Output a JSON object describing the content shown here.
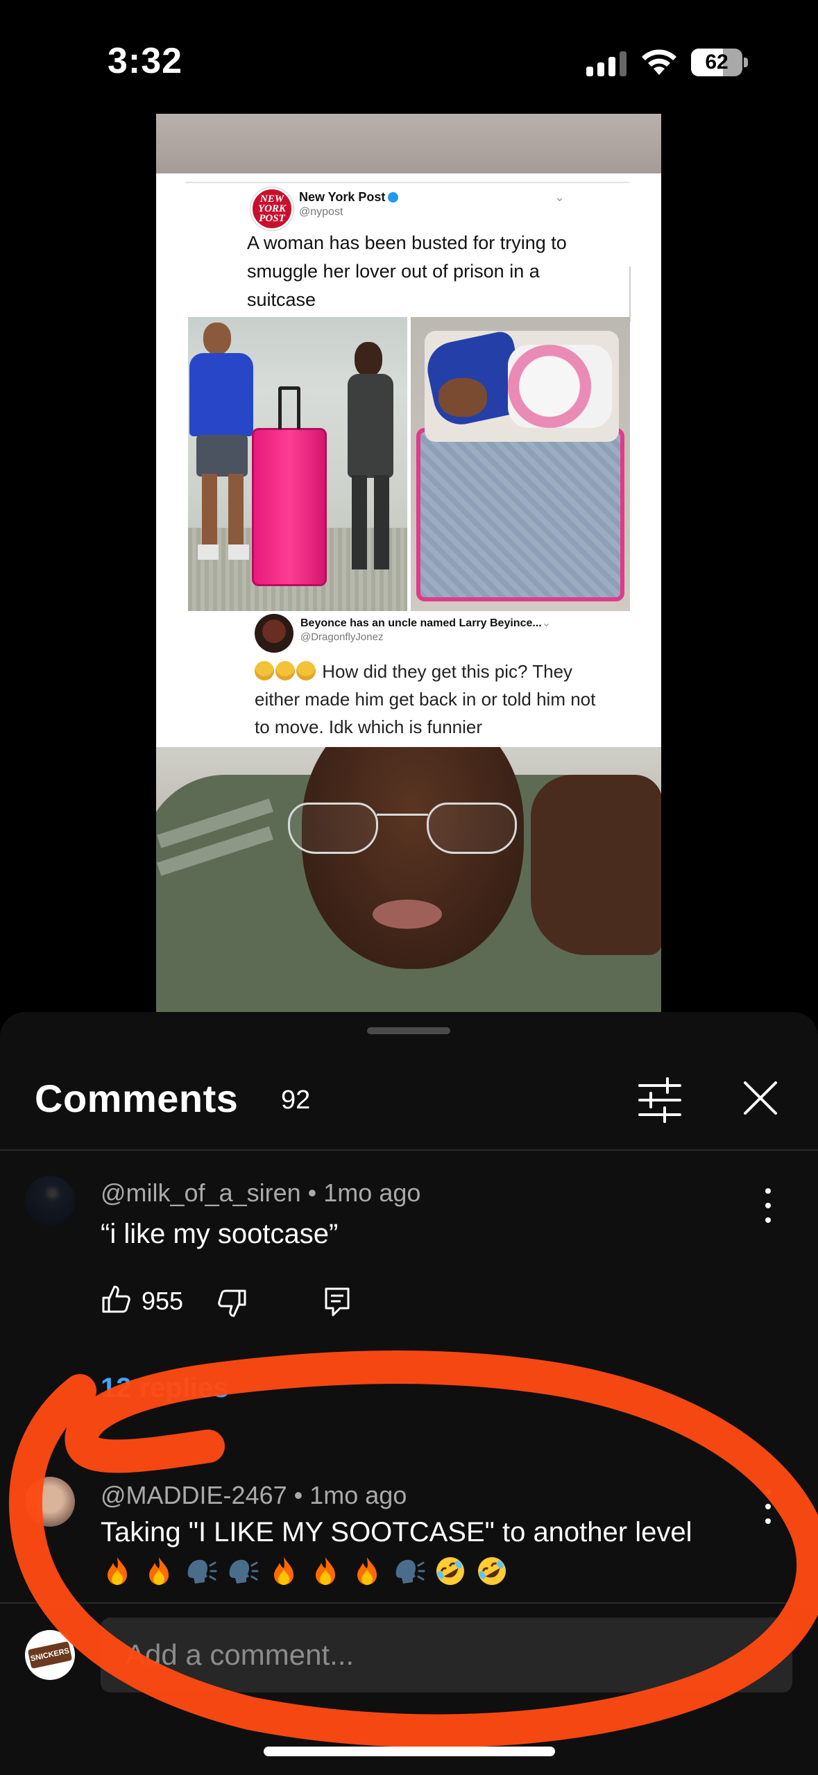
{
  "status_bar": {
    "time": "3:32",
    "battery": "62",
    "battery_level": 0.62
  },
  "video": {
    "tweet": {
      "account_name": "New York Post",
      "handle": "@nypost",
      "logo_text": [
        "NEW",
        "YORK",
        "POST"
      ],
      "text": "A woman has been busted for trying to smuggle her lover out of prison in a suitcase"
    },
    "reply": {
      "name": "Beyonce has an uncle named Larry Beyince...",
      "handle": "@DragonflyJonez",
      "text": "How did they get this pic? They either made him get back in or told him not to move. Idk which is funnier"
    }
  },
  "comments_panel": {
    "title": "Comments",
    "count": "92",
    "comments": [
      {
        "author": "@milk_of_a_siren",
        "age": "1mo ago",
        "text": "“i like my sootcase”",
        "likes": "955",
        "replies_label": "12 replies"
      },
      {
        "author": "@MADDIE-2467",
        "age": "1mo ago",
        "text": "Taking \"I LIKE MY SOOTCASE\" to another level",
        "emojis": [
          "fire",
          "fire",
          "speaking-head",
          "speaking-head",
          "fire",
          "fire",
          "fire",
          "speaking-head",
          "rofl",
          "rofl"
        ]
      }
    ],
    "input_placeholder": "Add a comment...",
    "avatar_label": "SNICKERS"
  },
  "colors": {
    "sheet_bg": "#0f0f0f",
    "link_blue": "#3ea6ff",
    "annotation_orange": "#ff4a12"
  }
}
